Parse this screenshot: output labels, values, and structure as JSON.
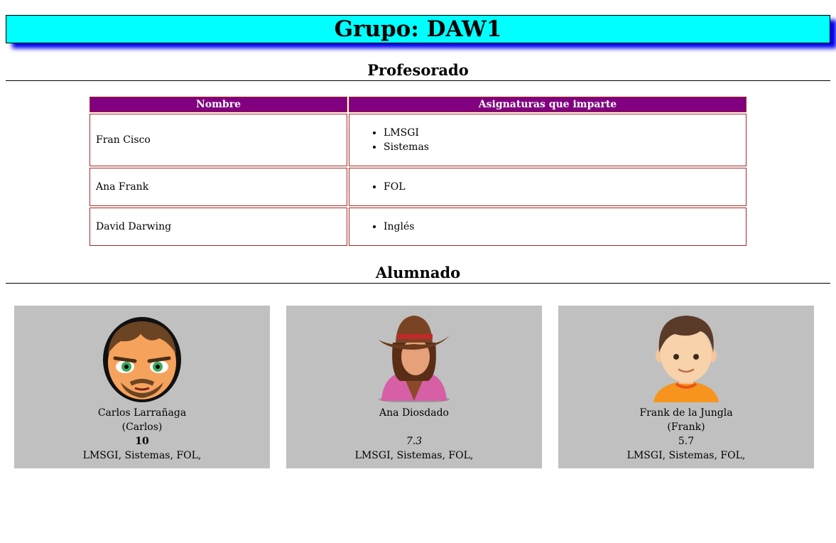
{
  "header": {
    "title": "Grupo: DAW1"
  },
  "teachers_section": {
    "title": "Profesorado",
    "columns": [
      "Nombre",
      "Asignaturas que imparte"
    ],
    "rows": [
      {
        "name": "Fran Cisco",
        "subjects": [
          "LMSGI",
          "Sistemas"
        ]
      },
      {
        "name": "Ana Frank",
        "subjects": [
          "FOL"
        ]
      },
      {
        "name": "David Darwing",
        "subjects": [
          "Inglés"
        ]
      }
    ]
  },
  "students_section": {
    "title": "Alumnado",
    "students": [
      {
        "full_name": "Carlos Larrañaga",
        "nickname": "(Carlos)",
        "grade": "10",
        "subjects": "LMSGI, Sistemas, FOL,",
        "avatar": "man-beard-avatar-icon"
      },
      {
        "full_name": "Ana Diosdado",
        "nickname": "",
        "grade": "7.3",
        "subjects": "LMSGI, Sistemas, FOL,",
        "avatar": "cowgirl-avatar-icon"
      },
      {
        "full_name": "Frank de la Jungla",
        "nickname": "(Frank)",
        "grade": "5.7",
        "subjects": "LMSGI, Sistemas, FOL,",
        "avatar": "boy-avatar-icon"
      }
    ]
  },
  "colors": {
    "title_bg": "#00ffff",
    "title_shadow": "#0000ee",
    "table_header_bg": "#800080",
    "table_border": "#a52a2a",
    "card_bg": "#c0c0c0"
  }
}
